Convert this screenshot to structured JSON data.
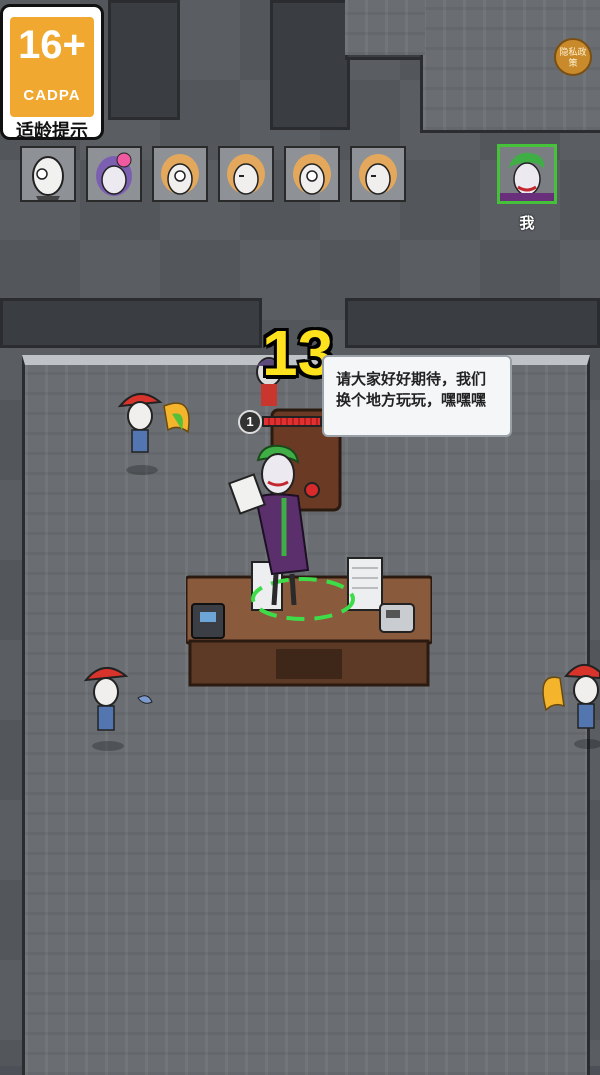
{
  "age_rating": {
    "number": "16+",
    "org": "CADPA",
    "tip": "适龄提示"
  },
  "privacy_button": {
    "label": "隐私政策"
  },
  "players": [
    {
      "icon": "bald-man-avatar"
    },
    {
      "icon": "purple-hair-flower-girl-avatar"
    },
    {
      "icon": "blonde-girl-avatar"
    },
    {
      "icon": "blonde-girl-avatar"
    },
    {
      "icon": "blonde-girl-avatar"
    },
    {
      "icon": "blonde-girl-avatar"
    }
  ],
  "me": {
    "icon": "joker-avatar",
    "label": "我"
  },
  "countdown": "13",
  "boss": {
    "level": "1",
    "speech": "请大家好好期待，我们换个地方玩玩，嘿嘿嘿"
  },
  "colors": {
    "accent_yellow": "#ffe21e",
    "me_border": "#45c23a",
    "badge_orange": "#f0a830",
    "hp_red": "#e03030"
  }
}
